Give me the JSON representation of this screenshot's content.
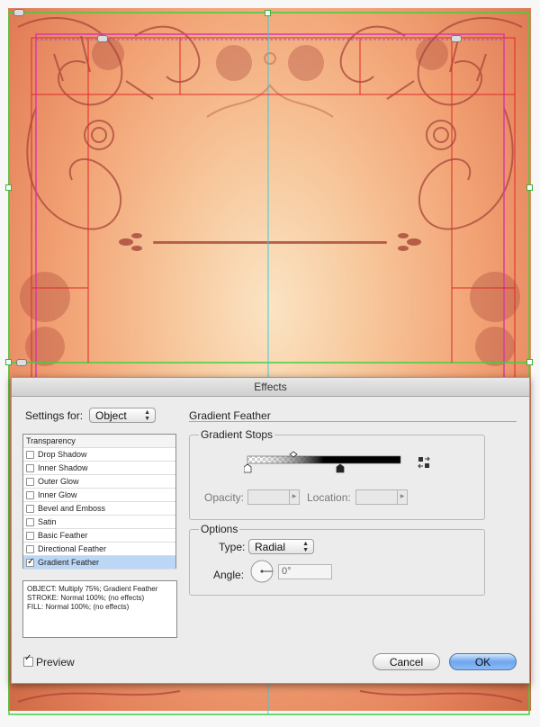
{
  "dialog": {
    "title": "Effects",
    "settings_label": "Settings for:",
    "settings_value": "Object",
    "panel_title": "Gradient Feather",
    "effects": [
      {
        "label": "Transparency",
        "checked": false,
        "header": true
      },
      {
        "label": "Drop Shadow",
        "checked": false
      },
      {
        "label": "Inner Shadow",
        "checked": false
      },
      {
        "label": "Outer Glow",
        "checked": false
      },
      {
        "label": "Inner Glow",
        "checked": false
      },
      {
        "label": "Bevel and Emboss",
        "checked": false
      },
      {
        "label": "Satin",
        "checked": false
      },
      {
        "label": "Basic Feather",
        "checked": false
      },
      {
        "label": "Directional Feather",
        "checked": false
      },
      {
        "label": "Gradient Feather",
        "checked": true,
        "selected": true
      }
    ],
    "summary": [
      "OBJECT: Multiply 75%; Gradient Feather",
      "STROKE: Normal 100%; (no effects)",
      "FILL: Normal 100%; (no effects)"
    ],
    "gradient_stops": {
      "title": "Gradient Stops",
      "opacity_label": "Opacity:",
      "location_label": "Location:"
    },
    "options": {
      "title": "Options",
      "type_label": "Type:",
      "type_value": "Radial",
      "angle_label": "Angle:",
      "angle_value": "0°"
    },
    "preview_label": "Preview",
    "preview_checked": true,
    "cancel_label": "Cancel",
    "ok_label": "OK"
  },
  "colors": {
    "guide_green": "#3fd13f",
    "guide_magenta": "#d83aa8",
    "guide_red": "#e0282a",
    "guide_cyan": "#40c8d8",
    "ornament": "#a8463a",
    "selected_row": "#bcd7f6",
    "ok_button": "#6ea6ee"
  }
}
